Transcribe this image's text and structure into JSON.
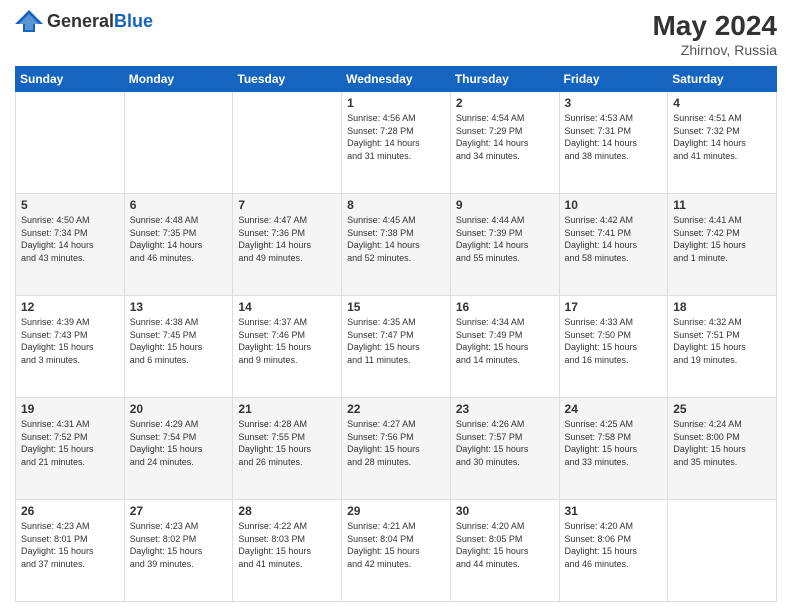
{
  "header": {
    "logo_general": "General",
    "logo_blue": "Blue",
    "title": "May 2024",
    "location": "Zhirnov, Russia"
  },
  "days_of_week": [
    "Sunday",
    "Monday",
    "Tuesday",
    "Wednesday",
    "Thursday",
    "Friday",
    "Saturday"
  ],
  "weeks": [
    [
      {
        "day": "",
        "info": ""
      },
      {
        "day": "",
        "info": ""
      },
      {
        "day": "",
        "info": ""
      },
      {
        "day": "1",
        "info": "Sunrise: 4:56 AM\nSunset: 7:28 PM\nDaylight: 14 hours\nand 31 minutes."
      },
      {
        "day": "2",
        "info": "Sunrise: 4:54 AM\nSunset: 7:29 PM\nDaylight: 14 hours\nand 34 minutes."
      },
      {
        "day": "3",
        "info": "Sunrise: 4:53 AM\nSunset: 7:31 PM\nDaylight: 14 hours\nand 38 minutes."
      },
      {
        "day": "4",
        "info": "Sunrise: 4:51 AM\nSunset: 7:32 PM\nDaylight: 14 hours\nand 41 minutes."
      }
    ],
    [
      {
        "day": "5",
        "info": "Sunrise: 4:50 AM\nSunset: 7:34 PM\nDaylight: 14 hours\nand 43 minutes."
      },
      {
        "day": "6",
        "info": "Sunrise: 4:48 AM\nSunset: 7:35 PM\nDaylight: 14 hours\nand 46 minutes."
      },
      {
        "day": "7",
        "info": "Sunrise: 4:47 AM\nSunset: 7:36 PM\nDaylight: 14 hours\nand 49 minutes."
      },
      {
        "day": "8",
        "info": "Sunrise: 4:45 AM\nSunset: 7:38 PM\nDaylight: 14 hours\nand 52 minutes."
      },
      {
        "day": "9",
        "info": "Sunrise: 4:44 AM\nSunset: 7:39 PM\nDaylight: 14 hours\nand 55 minutes."
      },
      {
        "day": "10",
        "info": "Sunrise: 4:42 AM\nSunset: 7:41 PM\nDaylight: 14 hours\nand 58 minutes."
      },
      {
        "day": "11",
        "info": "Sunrise: 4:41 AM\nSunset: 7:42 PM\nDaylight: 15 hours\nand 1 minute."
      }
    ],
    [
      {
        "day": "12",
        "info": "Sunrise: 4:39 AM\nSunset: 7:43 PM\nDaylight: 15 hours\nand 3 minutes."
      },
      {
        "day": "13",
        "info": "Sunrise: 4:38 AM\nSunset: 7:45 PM\nDaylight: 15 hours\nand 6 minutes."
      },
      {
        "day": "14",
        "info": "Sunrise: 4:37 AM\nSunset: 7:46 PM\nDaylight: 15 hours\nand 9 minutes."
      },
      {
        "day": "15",
        "info": "Sunrise: 4:35 AM\nSunset: 7:47 PM\nDaylight: 15 hours\nand 11 minutes."
      },
      {
        "day": "16",
        "info": "Sunrise: 4:34 AM\nSunset: 7:49 PM\nDaylight: 15 hours\nand 14 minutes."
      },
      {
        "day": "17",
        "info": "Sunrise: 4:33 AM\nSunset: 7:50 PM\nDaylight: 15 hours\nand 16 minutes."
      },
      {
        "day": "18",
        "info": "Sunrise: 4:32 AM\nSunset: 7:51 PM\nDaylight: 15 hours\nand 19 minutes."
      }
    ],
    [
      {
        "day": "19",
        "info": "Sunrise: 4:31 AM\nSunset: 7:52 PM\nDaylight: 15 hours\nand 21 minutes."
      },
      {
        "day": "20",
        "info": "Sunrise: 4:29 AM\nSunset: 7:54 PM\nDaylight: 15 hours\nand 24 minutes."
      },
      {
        "day": "21",
        "info": "Sunrise: 4:28 AM\nSunset: 7:55 PM\nDaylight: 15 hours\nand 26 minutes."
      },
      {
        "day": "22",
        "info": "Sunrise: 4:27 AM\nSunset: 7:56 PM\nDaylight: 15 hours\nand 28 minutes."
      },
      {
        "day": "23",
        "info": "Sunrise: 4:26 AM\nSunset: 7:57 PM\nDaylight: 15 hours\nand 30 minutes."
      },
      {
        "day": "24",
        "info": "Sunrise: 4:25 AM\nSunset: 7:58 PM\nDaylight: 15 hours\nand 33 minutes."
      },
      {
        "day": "25",
        "info": "Sunrise: 4:24 AM\nSunset: 8:00 PM\nDaylight: 15 hours\nand 35 minutes."
      }
    ],
    [
      {
        "day": "26",
        "info": "Sunrise: 4:23 AM\nSunset: 8:01 PM\nDaylight: 15 hours\nand 37 minutes."
      },
      {
        "day": "27",
        "info": "Sunrise: 4:23 AM\nSunset: 8:02 PM\nDaylight: 15 hours\nand 39 minutes."
      },
      {
        "day": "28",
        "info": "Sunrise: 4:22 AM\nSunset: 8:03 PM\nDaylight: 15 hours\nand 41 minutes."
      },
      {
        "day": "29",
        "info": "Sunrise: 4:21 AM\nSunset: 8:04 PM\nDaylight: 15 hours\nand 42 minutes."
      },
      {
        "day": "30",
        "info": "Sunrise: 4:20 AM\nSunset: 8:05 PM\nDaylight: 15 hours\nand 44 minutes."
      },
      {
        "day": "31",
        "info": "Sunrise: 4:20 AM\nSunset: 8:06 PM\nDaylight: 15 hours\nand 46 minutes."
      },
      {
        "day": "",
        "info": ""
      }
    ]
  ]
}
